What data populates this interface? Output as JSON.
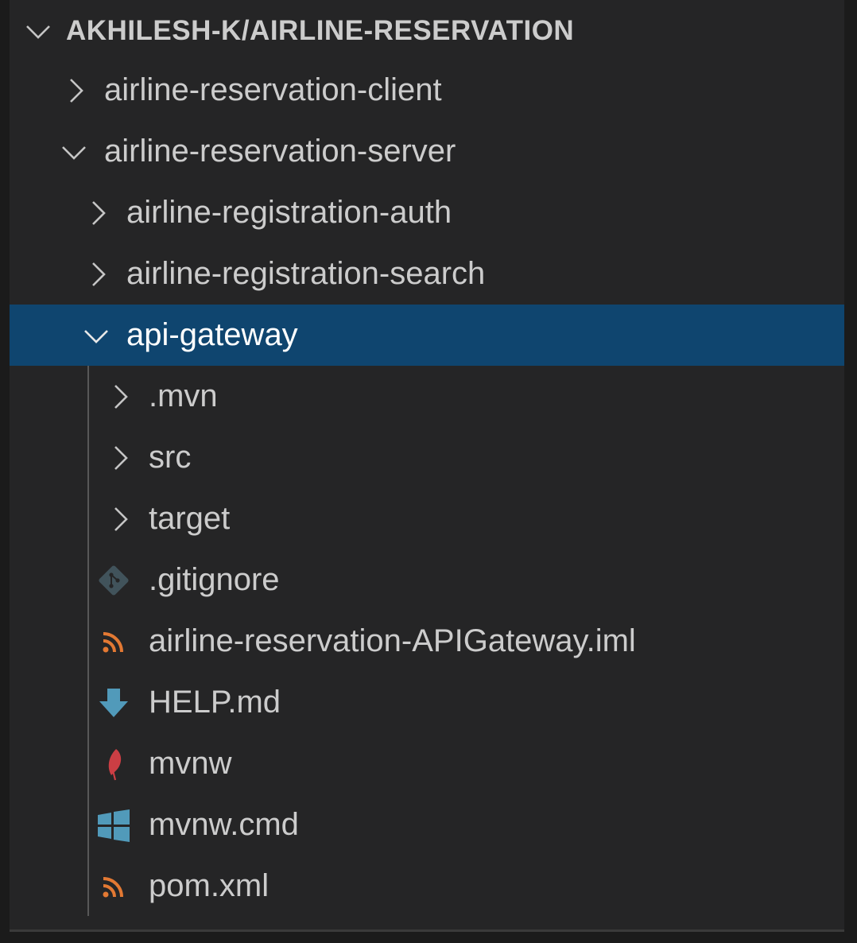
{
  "explorer": {
    "root": {
      "label": "AKHILESH-K/AIRLINE-RESERVATION",
      "expanded": true
    },
    "items": [
      {
        "label": "airline-reservation-client",
        "type": "folder",
        "expanded": false
      },
      {
        "label": "airline-reservation-server",
        "type": "folder",
        "expanded": true
      },
      {
        "label": "airline-registration-auth",
        "type": "folder",
        "expanded": false
      },
      {
        "label": "airline-registration-search",
        "type": "folder",
        "expanded": false
      },
      {
        "label": "api-gateway",
        "type": "folder",
        "expanded": true,
        "selected": true
      },
      {
        "label": ".mvn",
        "type": "folder",
        "expanded": false
      },
      {
        "label": "src",
        "type": "folder",
        "expanded": false
      },
      {
        "label": "target",
        "type": "folder",
        "expanded": false
      },
      {
        "label": ".gitignore",
        "type": "file",
        "icon": "git-icon"
      },
      {
        "label": "airline-reservation-APIGateway.iml",
        "type": "file",
        "icon": "rss-icon"
      },
      {
        "label": "HELP.md",
        "type": "file",
        "icon": "download-arrow-icon"
      },
      {
        "label": "mvnw",
        "type": "file",
        "icon": "feather-icon"
      },
      {
        "label": "mvnw.cmd",
        "type": "file",
        "icon": "windows-icon"
      },
      {
        "label": "pom.xml",
        "type": "file",
        "icon": "rss-icon"
      }
    ]
  },
  "colors": {
    "panel_background": "#252526",
    "selection_background": "#0f456f",
    "text": "#cccccc",
    "rss_orange": "#e37933",
    "git_blue": "#41535b",
    "download_blue": "#519aba",
    "feather_red": "#cc3e44",
    "windows_blue": "#519aba"
  }
}
